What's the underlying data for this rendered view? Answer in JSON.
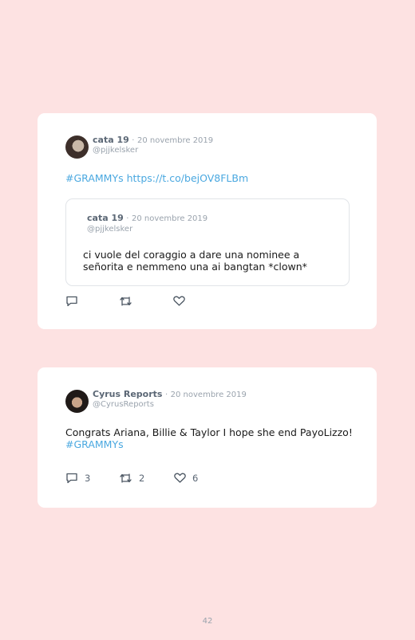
{
  "tweets": [
    {
      "author": "cata 19",
      "separator": "·",
      "date": "20 novembre 2019",
      "handle": "@pjjkelsker",
      "text_hashtag": "#GRAMMYs",
      "text_link": "https://t.co/bejOV8FLBm",
      "quote": {
        "author": "cata 19",
        "separator": "·",
        "date": "20 novembre 2019",
        "handle": "@pjjkelsker",
        "text": "ci vuole del coraggio a dare una nominee a señorita e nemmeno una ai bangtan *clown*"
      },
      "icons": [
        "reply-icon",
        "retweet-icon",
        "like-icon"
      ]
    },
    {
      "author": "Cyrus Reports",
      "separator": "·",
      "date": "20 novembre 2019",
      "handle": "@CyrusReports",
      "text": "Congrats Ariana, Billie & Taylor I hope she end PayoLizzo!",
      "text_hashtag": "#GRAMMYs",
      "replies": "3",
      "retweets": "2",
      "likes": "6",
      "icons": [
        "reply-icon",
        "retweet-icon",
        "like-icon"
      ]
    }
  ],
  "page_number": "42",
  "colors": {
    "background": "#fde2e2",
    "card": "#ffffff",
    "link": "#4aa8e0",
    "muted": "#9aa3ad"
  }
}
